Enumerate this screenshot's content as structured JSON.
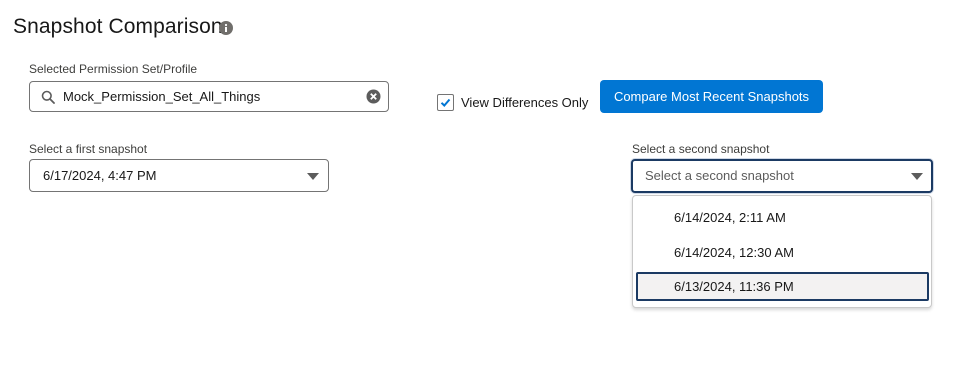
{
  "header": {
    "title": "Snapshot Comparison",
    "info_icon": "info-icon"
  },
  "permission_set": {
    "label": "Selected Permission Set/Profile",
    "value": "Mock_Permission_Set_All_Things",
    "search_icon": "search-icon",
    "clear_icon": "clear-icon"
  },
  "view_differences": {
    "label": "View Differences Only",
    "checked": true
  },
  "compare_button": {
    "label": "Compare Most Recent Snapshots",
    "color": "#0176d3"
  },
  "first_snapshot": {
    "label": "Select a first snapshot",
    "value": "6/17/2024, 4:47 PM"
  },
  "second_snapshot": {
    "label": "Select a second snapshot",
    "placeholder": "Select a second snapshot",
    "options": [
      "6/14/2024, 2:11 AM",
      "6/14/2024, 12:30 AM",
      "6/13/2024, 11:36 PM"
    ],
    "highlighted_option": "6/13/2024, 11:36 PM"
  }
}
